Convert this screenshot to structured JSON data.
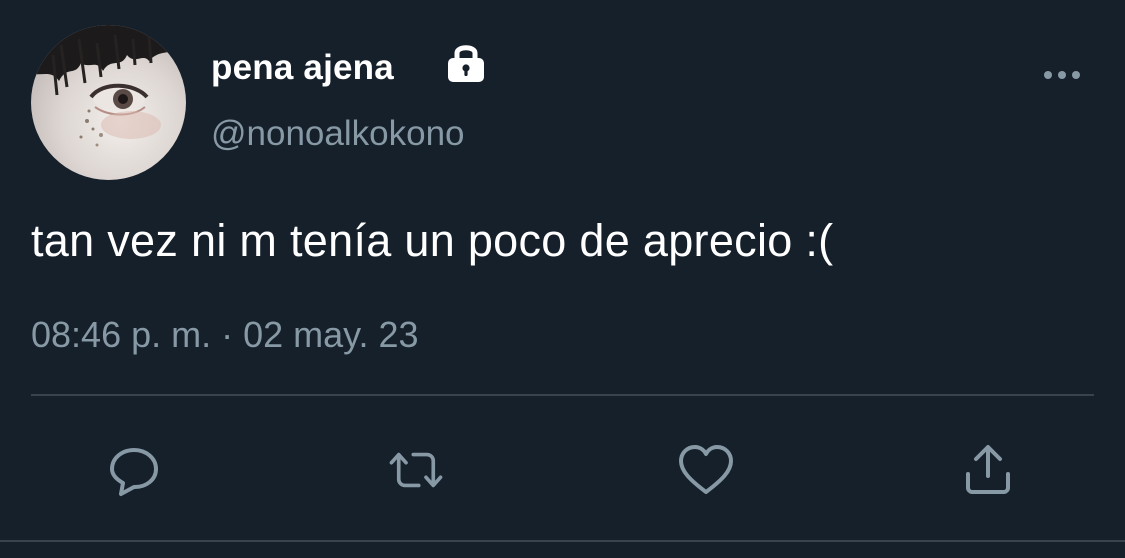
{
  "tweet": {
    "author": {
      "display_name": "pena ajena",
      "handle": "@nonoalkokono",
      "protected": true
    },
    "text": "tan vez ni m tenía un poco de aprecio :(",
    "timestamp": "08:46 p. m. · 02 may. 23"
  },
  "icons": {
    "lock": "lock-icon",
    "more": "more-horizontal-icon",
    "reply": "speech-bubble-icon",
    "retweet": "retweet-icon",
    "like": "heart-icon",
    "share": "share-icon"
  },
  "colors": {
    "background": "#15202b",
    "primary_text": "#ffffff",
    "secondary_text": "#8899a6",
    "divider": "#38444d"
  }
}
